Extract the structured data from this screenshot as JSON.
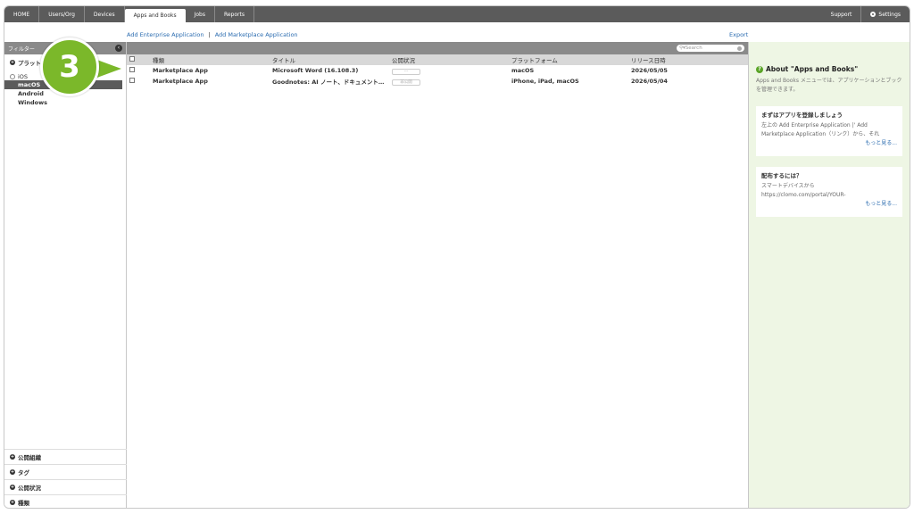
{
  "topnav": {
    "items": [
      "HOME",
      "Users/Org",
      "Devices",
      "Apps and Books",
      "Jobs",
      "Reports"
    ],
    "active": "Apps and Books",
    "support": "Support",
    "settings": "Settings"
  },
  "actions": {
    "add_enterprise": "Add Enterprise Application",
    "separator": "|",
    "add_marketplace": "Add Marketplace Application",
    "export": "Export"
  },
  "sidebar": {
    "filter_label": "フィルター",
    "collapse_icon": "chevron-left-icon",
    "platform_section": "プラット",
    "ios_label": "iOS",
    "sub_items": [
      "macOS",
      "Android",
      "Windows"
    ],
    "selected": "macOS",
    "bottom_sections": [
      "公開組織",
      "タグ",
      "公開状況",
      "種類"
    ]
  },
  "badge": {
    "number": "3",
    "color": "#7bb82a"
  },
  "search": {
    "placeholder": "Search"
  },
  "table": {
    "headers": [
      "種類",
      "タイトル",
      "公開状況",
      "プラットフォーム",
      "リリース日時"
    ],
    "rows": [
      {
        "type": "Marketplace App",
        "title": "Microsoft Word (16.108.3)",
        "status": "---",
        "platform": "macOS",
        "release": "2026/05/05"
      },
      {
        "type": "Marketplace App",
        "title": "Goodnotes: AI ノート、ドキュメント…",
        "status": "非公開",
        "platform": "iPhone, iPad, macOS",
        "release": "2026/05/04"
      }
    ]
  },
  "help": {
    "title": "About \"Apps and Books\"",
    "desc": "Apps and Books メニューでは、アプリケーションとブックを管理できます。",
    "card1": {
      "title": "まずはアプリを登録しましょう",
      "body": "左上の Add Enterprise Application |' Add Marketplace Application（リンク）から、それ",
      "more": "もっと見る..."
    },
    "card2": {
      "title": "配布するには？",
      "body1": "スマートデバイスから",
      "body2": "https://clomo.com/portal/YOUR-",
      "more": "もっと見る..."
    }
  }
}
